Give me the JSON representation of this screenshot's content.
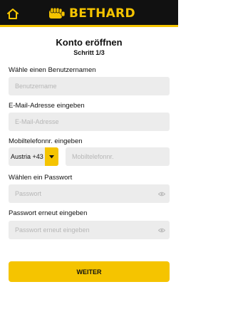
{
  "header": {
    "brand": "BETHARD",
    "accent_color": "#f5c400",
    "background_color": "#111111",
    "home_icon": "home-icon",
    "logo_icon": "fist-icon"
  },
  "page": {
    "title": "Konto eröffnen",
    "step": "Schritt 1/3"
  },
  "form": {
    "username": {
      "label": "Wähle einen Benutzernamen",
      "placeholder": "Benutzername",
      "value": ""
    },
    "email": {
      "label": "E-Mail-Adresse eingeben",
      "placeholder": "E-Mail-Adresse",
      "value": ""
    },
    "phone": {
      "label": "Mobiltelefonnr. eingeben",
      "country": "Austria +43",
      "placeholder": "Mobiltelefonnr.",
      "value": ""
    },
    "password": {
      "label": "Wählen ein Passwort",
      "placeholder": "Passwort",
      "value": "",
      "toggle_icon": "eye-icon"
    },
    "password_repeat": {
      "label": "Passwort erneut eingeben",
      "placeholder": "Passwort erneut eingeben",
      "value": "",
      "toggle_icon": "eye-icon"
    },
    "submit_label": "WEITER"
  }
}
